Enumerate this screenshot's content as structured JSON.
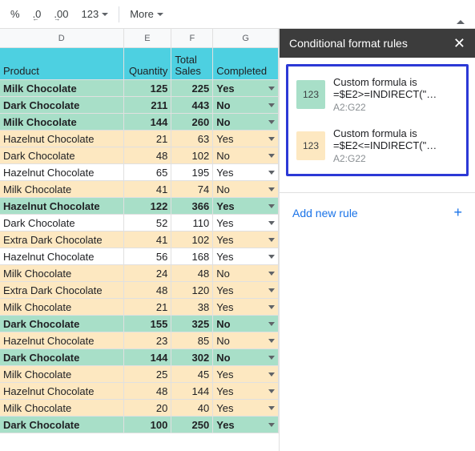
{
  "toolbar": {
    "percent": "%",
    "dec_dec": ".0",
    "dec_inc": ".00",
    "num_fmt": "123",
    "more": "More"
  },
  "columns": [
    "D",
    "E",
    "F",
    "G"
  ],
  "headers": {
    "product": "Product",
    "quantity": "Quantity",
    "total": "Total",
    "sales": "Sales",
    "completed": "Completed"
  },
  "rows": [
    {
      "p": "Milk Chocolate",
      "q": "125",
      "s": "225",
      "c": "Yes",
      "bg": "bg-green",
      "bold": true
    },
    {
      "p": "Dark Chocolate",
      "q": "211",
      "s": "443",
      "c": "No",
      "bg": "bg-green",
      "bold": true
    },
    {
      "p": "Milk Chocolate",
      "q": "144",
      "s": "260",
      "c": "No",
      "bg": "bg-green",
      "bold": true
    },
    {
      "p": "Hazelnut Chocolate",
      "q": "21",
      "s": "63",
      "c": "Yes",
      "bg": "bg-yellow",
      "bold": false
    },
    {
      "p": "Dark Chocolate",
      "q": "48",
      "s": "102",
      "c": "No",
      "bg": "bg-yellow",
      "bold": false
    },
    {
      "p": "Hazelnut Chocolate",
      "q": "65",
      "s": "195",
      "c": "Yes",
      "bg": "bg-white",
      "bold": false
    },
    {
      "p": "Milk Chocolate",
      "q": "41",
      "s": "74",
      "c": "No",
      "bg": "bg-yellow",
      "bold": false
    },
    {
      "p": "Hazelnut Chocolate",
      "q": "122",
      "s": "366",
      "c": "Yes",
      "bg": "bg-green",
      "bold": true
    },
    {
      "p": "Dark Chocolate",
      "q": "52",
      "s": "110",
      "c": "Yes",
      "bg": "bg-white",
      "bold": false
    },
    {
      "p": "Extra Dark Chocolate",
      "q": "41",
      "s": "102",
      "c": "Yes",
      "bg": "bg-yellow",
      "bold": false
    },
    {
      "p": "Hazelnut Chocolate",
      "q": "56",
      "s": "168",
      "c": "Yes",
      "bg": "bg-white",
      "bold": false
    },
    {
      "p": "Milk Chocolate",
      "q": "24",
      "s": "48",
      "c": "No",
      "bg": "bg-yellow",
      "bold": false
    },
    {
      "p": "Extra Dark Chocolate",
      "q": "48",
      "s": "120",
      "c": "Yes",
      "bg": "bg-yellow",
      "bold": false
    },
    {
      "p": "Milk Chocolate",
      "q": "21",
      "s": "38",
      "c": "Yes",
      "bg": "bg-yellow",
      "bold": false
    },
    {
      "p": "Dark Chocolate",
      "q": "155",
      "s": "325",
      "c": "No",
      "bg": "bg-green",
      "bold": true
    },
    {
      "p": "Hazelnut Chocolate",
      "q": "23",
      "s": "85",
      "c": "No",
      "bg": "bg-yellow",
      "bold": false
    },
    {
      "p": "Dark Chocolate",
      "q": "144",
      "s": "302",
      "c": "No",
      "bg": "bg-green",
      "bold": true
    },
    {
      "p": "Milk Chocolate",
      "q": "25",
      "s": "45",
      "c": "Yes",
      "bg": "bg-yellow",
      "bold": false
    },
    {
      "p": "Hazelnut Chocolate",
      "q": "48",
      "s": "144",
      "c": "Yes",
      "bg": "bg-yellow",
      "bold": false
    },
    {
      "p": "Milk Chocolate",
      "q": "20",
      "s": "40",
      "c": "Yes",
      "bg": "bg-yellow",
      "bold": false
    },
    {
      "p": "Dark Chocolate",
      "q": "100",
      "s": "250",
      "c": "Yes",
      "bg": "bg-green",
      "bold": true
    }
  ],
  "panel": {
    "title": "Conditional format rules",
    "rules": [
      {
        "swatch": "sw-green",
        "title": "Custom formula is",
        "sub": "=$E2>=INDIRECT(\"…",
        "range": "A2:G22"
      },
      {
        "swatch": "sw-yellow",
        "title": "Custom formula is",
        "sub": "=$E2<=INDIRECT(\"…",
        "range": "A2:G22"
      }
    ],
    "swatch_text": "123",
    "add": "Add new rule"
  },
  "col_widths": {
    "d": 155,
    "e": 60,
    "f": 52,
    "g": 82
  }
}
